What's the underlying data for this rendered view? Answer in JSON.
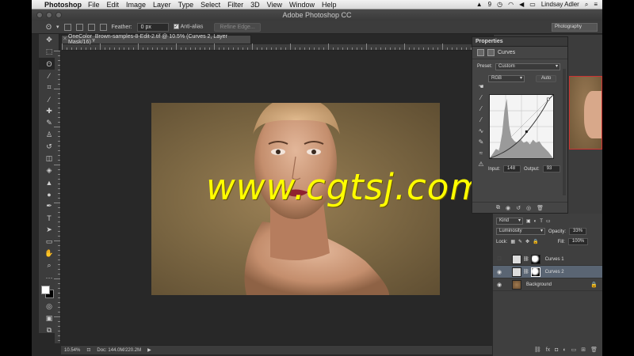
{
  "menubar": {
    "app": "Photoshop",
    "items": [
      "File",
      "Edit",
      "Image",
      "Layer",
      "Type",
      "Select",
      "Filter",
      "3D",
      "View",
      "Window",
      "Help"
    ],
    "user": "Lindsay Adler",
    "badge": "9"
  },
  "window": {
    "title": "Adobe Photoshop CC"
  },
  "options": {
    "feather_label": "Feather:",
    "feather_value": "0 px",
    "antialias_label": "Anti-alias",
    "refine_label": "Refine Edge...",
    "workspace": "Photography"
  },
  "document": {
    "tab_title": "OneColor_Brown-samples-8-Edit-2.tif @ 10.5% (Curves 2, Layer Mask/16) *",
    "zoom": "10.54%",
    "doc_size": "Doc: 144.0M/220.2M"
  },
  "watermark": "www.cgtsj.com",
  "properties": {
    "header": "Properties",
    "title": "Curves",
    "preset_label": "Preset:",
    "preset_value": "Custom",
    "channel": "RGB",
    "auto_label": "Auto",
    "input_label": "Input:",
    "input_value": "148",
    "output_label": "Output:",
    "output_value": "93"
  },
  "layers": {
    "kind_label": "Kind",
    "blend_mode": "Luminosity",
    "opacity_label": "Opacity:",
    "opacity_value": "33%",
    "lock_label": "Lock:",
    "fill_label": "Fill:",
    "fill_value": "100%",
    "items": [
      {
        "name": "Curves 1",
        "visible": false,
        "selected": false
      },
      {
        "name": "Curves 2",
        "visible": true,
        "selected": true
      },
      {
        "name": "Background",
        "visible": true,
        "selected": false
      }
    ]
  },
  "icons": {
    "accent": "#5a6573"
  }
}
